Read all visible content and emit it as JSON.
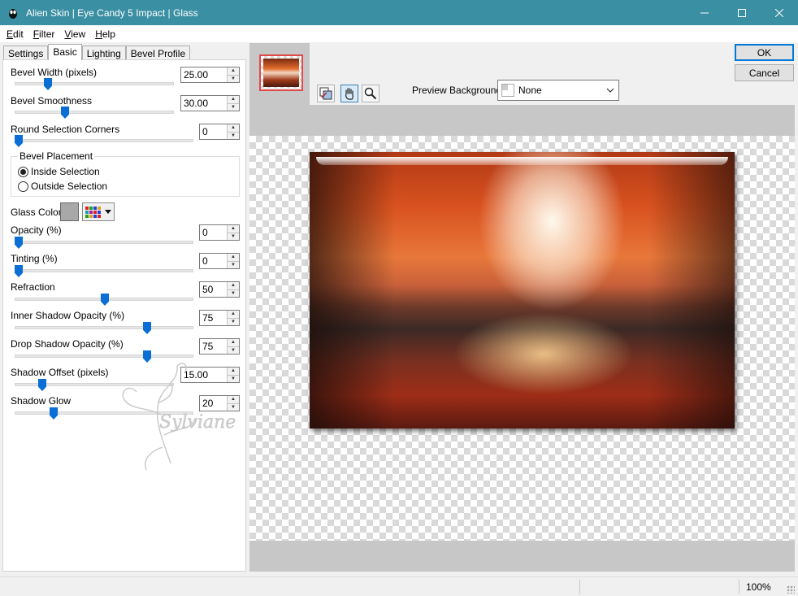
{
  "window": {
    "title": "Alien Skin | Eye Candy 5 Impact | Glass"
  },
  "menu": [
    {
      "first": "E",
      "rest": "dit"
    },
    {
      "first": "F",
      "rest": "ilter"
    },
    {
      "first": "V",
      "rest": "iew"
    },
    {
      "first": "H",
      "rest": "elp"
    }
  ],
  "tabs": [
    "Settings",
    "Basic",
    "Lighting",
    "Bevel Profile"
  ],
  "controls": {
    "bevel_width": {
      "label": "Bevel Width (pixels)",
      "value": "25.00"
    },
    "bevel_smoothness": {
      "label": "Bevel Smoothness",
      "value": "30.00"
    },
    "round_corners": {
      "label": "Round Selection Corners",
      "value": "0"
    },
    "bevel_placement": {
      "title": "Bevel Placement",
      "options": [
        "Inside Selection",
        "Outside Selection"
      ],
      "selected": "Inside Selection"
    },
    "glass_color": {
      "label": "Glass Color",
      "color": "#a8a8a8"
    },
    "opacity": {
      "label": "Opacity (%)",
      "value": "0"
    },
    "tinting": {
      "label": "Tinting (%)",
      "value": "0"
    },
    "refraction": {
      "label": "Refraction",
      "value": "50"
    },
    "inner_shadow": {
      "label": "Inner Shadow Opacity (%)",
      "value": "75"
    },
    "drop_shadow": {
      "label": "Drop Shadow Opacity (%)",
      "value": "75"
    },
    "shadow_offset": {
      "label": "Shadow Offset (pixels)",
      "value": "15.00"
    },
    "shadow_glow": {
      "label": "Shadow Glow",
      "value": "20"
    }
  },
  "watermark_text": "Sylviane",
  "preview": {
    "background_label": "Preview Background:",
    "background_value": "None"
  },
  "buttons": {
    "ok": "OK",
    "cancel": "Cancel"
  },
  "status": {
    "zoom": "100%"
  },
  "colors": {
    "titlebar": "#3a8fa3",
    "slider_thumb": "#0a6fd4",
    "ok_border": "#0078d7"
  },
  "icons": [
    "app-logo-icon",
    "minimize-icon",
    "maximize-icon",
    "close-icon",
    "preview-toggle-icon",
    "hand-pan-icon",
    "zoom-icon",
    "color-grid-icon"
  ]
}
